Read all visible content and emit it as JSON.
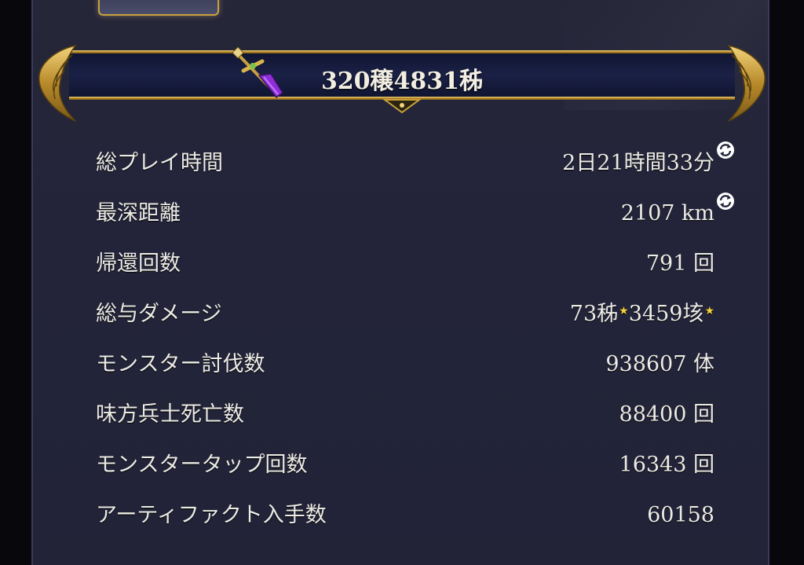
{
  "banner": {
    "title": "320穣4831秭",
    "icon": "sword-icon"
  },
  "stats": [
    {
      "label": "総プレイ時間",
      "value": "2日21時間33分",
      "has_refresh": true
    },
    {
      "label": "最深距離",
      "value": "2107 km",
      "has_refresh": true
    },
    {
      "label": "帰還回数",
      "value": "791 回"
    },
    {
      "label": "総与ダメージ",
      "value_part1": "73秭",
      "value_part2": "3459垓",
      "star_icon": "star-icon"
    },
    {
      "label": "モンスター討伐数",
      "value": "938607 体"
    },
    {
      "label": "味方兵士死亡数",
      "value": "88400 回"
    },
    {
      "label": "モンスタータップ回数",
      "value": "16343 回"
    },
    {
      "label": "アーティファクト入手数",
      "value": "60158"
    }
  ],
  "colors": {
    "panel_bg": "#23243a",
    "gold": "#c9a13c",
    "text": "#ecebe6",
    "star": "#f5d33a"
  }
}
